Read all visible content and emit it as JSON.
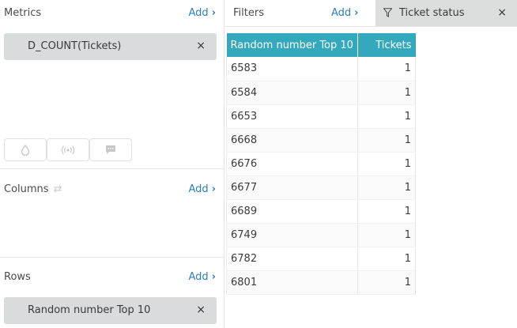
{
  "metrics": {
    "title": "Metrics",
    "add_label": "Add",
    "chevron": "›",
    "pill_label": "D_COUNT(Tickets)",
    "pill_close": "×",
    "icon_buttons": [
      "drop-icon",
      "broadcast-icon",
      "comment-icon"
    ]
  },
  "columns": {
    "title": "Columns",
    "add_label": "Add",
    "chevron": "›",
    "swap_icon": "⇄"
  },
  "rows": {
    "title": "Rows",
    "add_label": "Add",
    "chevron": "›",
    "pill_label": "Random number Top 10",
    "pill_close": "×"
  },
  "filters": {
    "title": "Filters",
    "add_label": "Add",
    "chevron": "›",
    "chip_label": "Ticket status",
    "chip_close": "×"
  },
  "table": {
    "headers": [
      "Random number Top 10",
      "Tickets"
    ],
    "rows": [
      [
        "6583",
        "1"
      ],
      [
        "6584",
        "1"
      ],
      [
        "6653",
        "1"
      ],
      [
        "6668",
        "1"
      ],
      [
        "6676",
        "1"
      ],
      [
        "6677",
        "1"
      ],
      [
        "6689",
        "1"
      ],
      [
        "6749",
        "1"
      ],
      [
        "6782",
        "1"
      ],
      [
        "6801",
        "1"
      ]
    ]
  },
  "colors": {
    "accent_link": "#2a7fc0",
    "table_header": "#34a9bd",
    "pill_bg": "#d9dcdc"
  }
}
